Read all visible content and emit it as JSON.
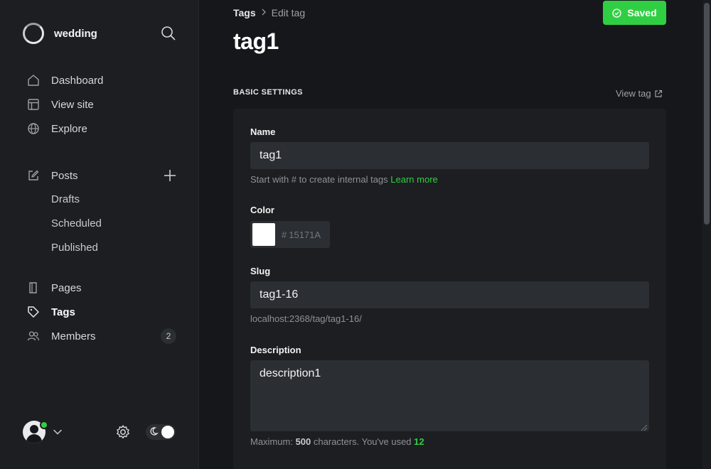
{
  "sidebar": {
    "site_name": "wedding",
    "nav": {
      "dashboard": "Dashboard",
      "view_site": "View site",
      "explore": "Explore",
      "posts": "Posts",
      "drafts": "Drafts",
      "scheduled": "Scheduled",
      "published": "Published",
      "pages": "Pages",
      "tags": "Tags",
      "members": "Members",
      "members_count": "2"
    }
  },
  "header": {
    "breadcrumb_root": "Tags",
    "breadcrumb_current": "Edit tag",
    "save_label": "Saved",
    "title": "tag1"
  },
  "settings": {
    "section_title": "BASIC SETTINGS",
    "view_tag_label": "View tag",
    "name": {
      "label": "Name",
      "value": "tag1",
      "hint": "Start with # to create internal tags",
      "hint_link": "Learn more"
    },
    "color": {
      "label": "Color",
      "hash": "#",
      "placeholder": "15171A",
      "swatch": "#ffffff"
    },
    "slug": {
      "label": "Slug",
      "value": "tag1-16",
      "url_preview": "localhost:2368/tag/tag1-16/"
    },
    "description": {
      "label": "Description",
      "value": "description1",
      "limit_prefix": "Maximum:",
      "limit_max": "500",
      "limit_mid": "characters. You've used",
      "limit_used": "12"
    }
  },
  "colors": {
    "accent_green": "#30cf43",
    "background": "#15171a",
    "sidebar": "#1c1e21",
    "input": "#2b2e32"
  }
}
